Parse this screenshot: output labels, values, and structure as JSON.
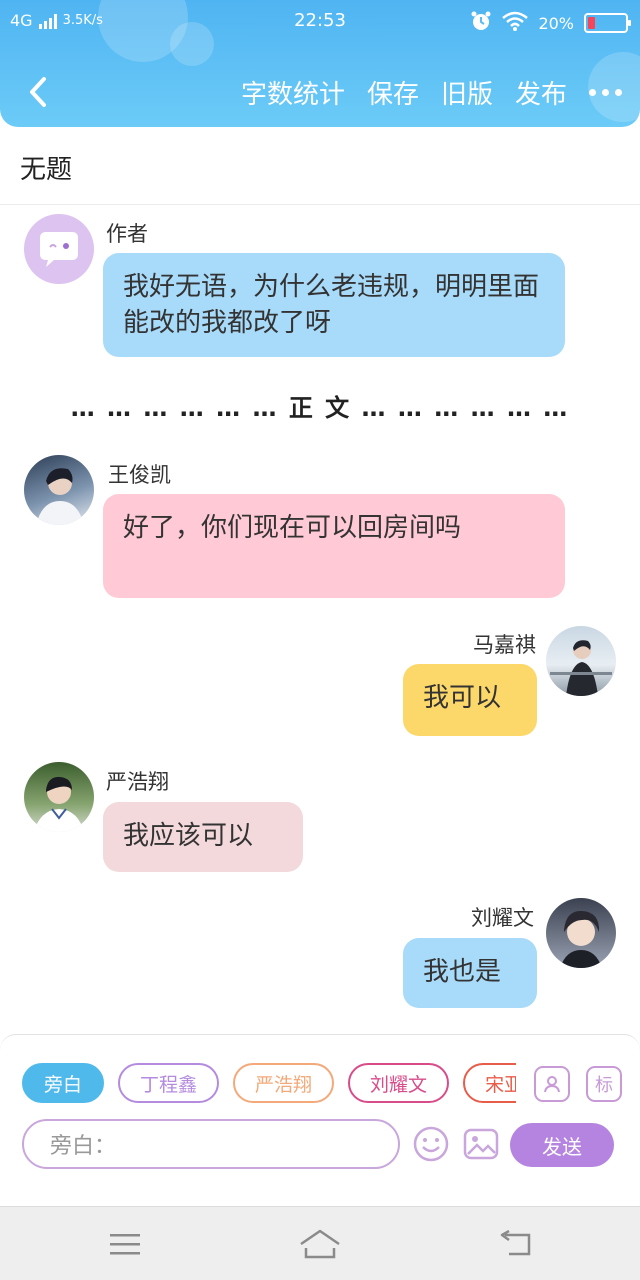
{
  "status_bar": {
    "network": "4G",
    "speed": "3.5K/s",
    "time": "22:53",
    "battery": "20%",
    "battery_level": 0.2,
    "battery_color": "#f5455b"
  },
  "header": {
    "back_icon": "chevron-left-icon",
    "actions": [
      "字数统计",
      "保存",
      "旧版",
      "发布"
    ],
    "more_icon": "more-dots-icon",
    "background": "#5bbdf4"
  },
  "title": "无题",
  "messages": [
    {
      "name": "作者",
      "text": "我好无语，为什么老违规，明明里面能改的我都改了呀",
      "side": "left",
      "color": "#a8daf9",
      "avatar": "author-chat-icon"
    },
    {
      "name": "王俊凯",
      "text": "好了，你们现在可以回房间吗",
      "side": "left",
      "color": "#ffc9d6",
      "avatar": "profile-photo"
    },
    {
      "name": "马嘉祺",
      "text": "我可以",
      "side": "right",
      "color": "#fcd86a",
      "avatar": "profile-photo"
    },
    {
      "name": "严浩翔",
      "text": "我应该可以",
      "side": "left",
      "color": "#f3d9dc",
      "avatar": "profile-photo"
    },
    {
      "name": "刘耀文",
      "text": "我也是",
      "side": "right",
      "color": "#a8daf9",
      "avatar": "profile-photo"
    }
  ],
  "divider": "… … … … … … 正 文 … … … … … …",
  "composer": {
    "chips": [
      {
        "label": "旁白",
        "color": "#4fb9ec",
        "active": true
      },
      {
        "label": "丁程鑫",
        "color": "#b58be0",
        "active": false
      },
      {
        "label": "严浩翔",
        "color": "#f3a97a",
        "active": false
      },
      {
        "label": "刘耀文",
        "color": "#d94c8a",
        "active": false
      },
      {
        "label": "宋亚轩",
        "color": "#e85c4a",
        "active": false
      }
    ],
    "tools": [
      "contact-card-icon",
      "tag-icon"
    ],
    "tag_label": "标",
    "input_placeholder": "旁白：",
    "emoji_icon": "smiley-icon",
    "image_icon": "image-icon",
    "send_label": "发送"
  },
  "system_nav": [
    "menu-icon",
    "home-icon",
    "back-icon"
  ]
}
